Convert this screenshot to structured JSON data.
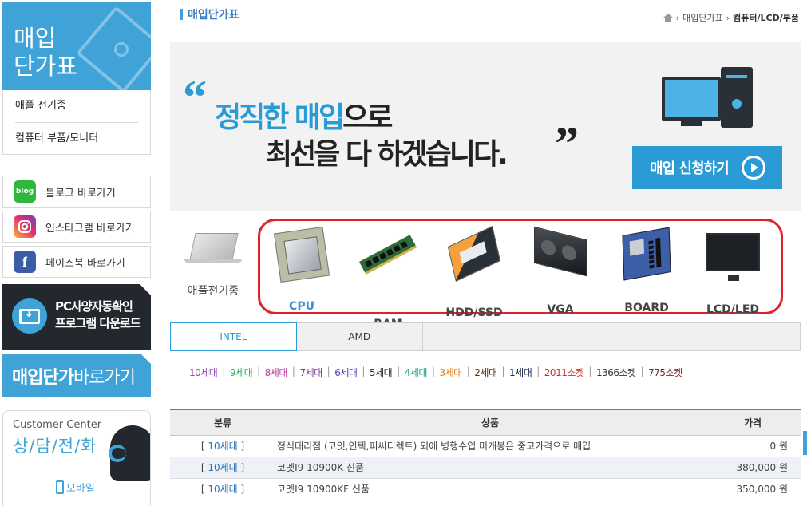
{
  "sidebar": {
    "hero_title_1": "매입",
    "hero_title_2": "단가표",
    "menu": [
      {
        "label": "애플 전기종"
      },
      {
        "label": "컴퓨터 부품/모니터"
      }
    ],
    "links": [
      {
        "icon": "blog-icon",
        "icon_text": "blog",
        "label": "블로그 바로가기"
      },
      {
        "icon": "instagram-icon",
        "icon_text": "",
        "label": "인스타그램 바로가기"
      },
      {
        "icon": "facebook-icon",
        "icon_text": "f",
        "label": "페이스북 바로가기"
      }
    ],
    "download_line1": "PC사양자동확인",
    "download_line2": "프로그램 다운로드",
    "price_bold": "매입단가",
    "price_light": "바로가기",
    "cc_en": "Customer Center",
    "cc_ko": "상/담/전/화",
    "cc_mobile": "모바일"
  },
  "header": {
    "title": "매입단가표",
    "breadcrumb": [
      "매입단가표",
      "컴퓨터/LCD/부품"
    ]
  },
  "banner": {
    "quote_open": "“",
    "quote_close": "”",
    "line1_hl": "정직한 매입",
    "line1_rest": "으로",
    "line2": "최선을 다 하겠습니다.",
    "apply_label": "매입 신청하기"
  },
  "categories": {
    "apple_label": "애플전기종",
    "items": [
      {
        "label": "CPU",
        "active": true
      },
      {
        "label": "RAM",
        "active": false
      },
      {
        "label": "HDD/SSD",
        "active": false
      },
      {
        "label": "VGA",
        "active": false
      },
      {
        "label": "BOARD",
        "active": false
      },
      {
        "label": "LCD/LED",
        "active": false
      }
    ]
  },
  "tabs": [
    {
      "label": "INTEL",
      "active": true
    },
    {
      "label": "AMD",
      "active": false
    },
    {
      "label": ""
    },
    {
      "label": ""
    },
    {
      "label": ""
    }
  ],
  "generations": [
    {
      "label": "10세대",
      "color": "#8e44ad"
    },
    {
      "label": "9세대",
      "color": "#27ae60"
    },
    {
      "label": "8세대",
      "color": "#c0399f"
    },
    {
      "label": "7세대",
      "color": "#7d3c98"
    },
    {
      "label": "6세대",
      "color": "#4b3fb0"
    },
    {
      "label": "5세대",
      "color": "#333333"
    },
    {
      "label": "4세대",
      "color": "#16a085"
    },
    {
      "label": "3세대",
      "color": "#e67e22"
    },
    {
      "label": "2세대",
      "color": "#6e2c00"
    },
    {
      "label": "1세대",
      "color": "#1a2a4a"
    },
    {
      "label": "2011소켓",
      "color": "#c0392b"
    },
    {
      "label": "1366소켓",
      "color": "#333333"
    },
    {
      "label": "775소켓",
      "color": "#7b2b2b"
    }
  ],
  "table": {
    "headers": [
      "분류",
      "상품",
      "가격"
    ],
    "rows": [
      {
        "category": "10세대",
        "product": "정식대리점 (코잇,인텍,피씨디렉트) 외에 병행수입 미개봉은 중고가격으로 매입",
        "price": "0 원"
      },
      {
        "category": "10세대",
        "product": "코멧I9 10900K 신품",
        "price": "380,000 원"
      },
      {
        "category": "10세대",
        "product": "코멧I9 10900KF 신품",
        "price": "350,000 원"
      }
    ]
  },
  "colors": {
    "accent": "#3fa3d8",
    "highlight_frame": "#e12127",
    "dark": "#23282e"
  }
}
